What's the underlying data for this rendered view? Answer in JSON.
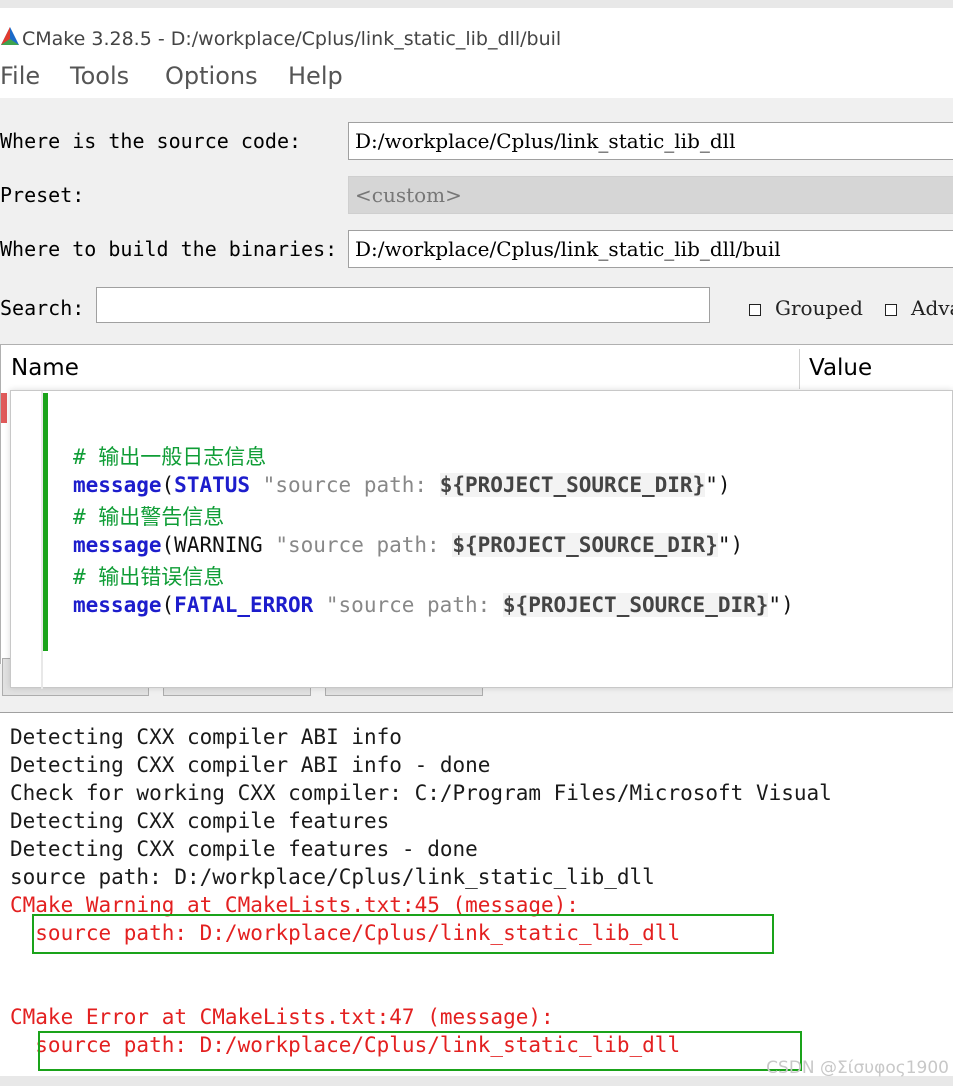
{
  "window": {
    "title": "CMake 3.28.5 - D:/workplace/Cplus/link_static_lib_dll/buil"
  },
  "menu": [
    "File",
    "Tools",
    "Options",
    "Help"
  ],
  "form": {
    "source_label": "Where is the source code:",
    "source_value": "D:/workplace/Cplus/link_static_lib_dll",
    "preset_label": "Preset:",
    "preset_value": "<custom>",
    "build_label": "Where to build the binaries:",
    "build_value": "D:/workplace/Cplus/link_static_lib_dll/buil",
    "search_label": "Search:",
    "search_value": "",
    "grouped_label": "Grouped",
    "advanced_label": "Adva"
  },
  "table": {
    "col_name": "Name",
    "col_value": "Value"
  },
  "code_popup": {
    "comment1": "# 输出一般日志信息",
    "cmd1": "message",
    "open1": "(",
    "arg1": "STATUS",
    "str1": " \"source path: ",
    "var1": "${PROJECT_SOURCE_DIR}",
    "end1": "\")",
    "comment2": "# 输出警告信息",
    "cmd2": "message",
    "open2": "(",
    "arg2": "WARNING",
    "str2": " \"source path: ",
    "var2": "${PROJECT_SOURCE_DIR}",
    "end2": "\")",
    "comment3": "# 输出错误信息",
    "cmd3": "message",
    "open3": "(",
    "arg3": "FATAL_ERROR",
    "str3": " \"source path: ",
    "var3": "${PROJECT_SOURCE_DIR}",
    "end3": "\")"
  },
  "output": {
    "lines": [
      "Detecting CXX compiler ABI info",
      "Detecting CXX compiler ABI info - done",
      "Check for working CXX compiler: C:/Program Files/Microsoft Visual",
      "Detecting CXX compile features",
      "Detecting CXX compile features - done",
      "source path: D:/workplace/Cplus/link_static_lib_dll"
    ],
    "warning_header": "CMake Warning at CMakeLists.txt:45 (message):",
    "warning_body": "  source path: D:/workplace/Cplus/link_static_lib_dll",
    "error_header": "CMake Error at CMakeLists.txt:47 (message):",
    "error_body": "  source path: D:/workplace/Cplus/link_static_lib_dll"
  },
  "watermark": "CSDN @Σίσυφος1900",
  "colors": {
    "accent_green": "#1aa31a",
    "error_red": "#e32020",
    "keyword_blue": "#1d1dcc",
    "comment_green": "#0f9d36"
  }
}
